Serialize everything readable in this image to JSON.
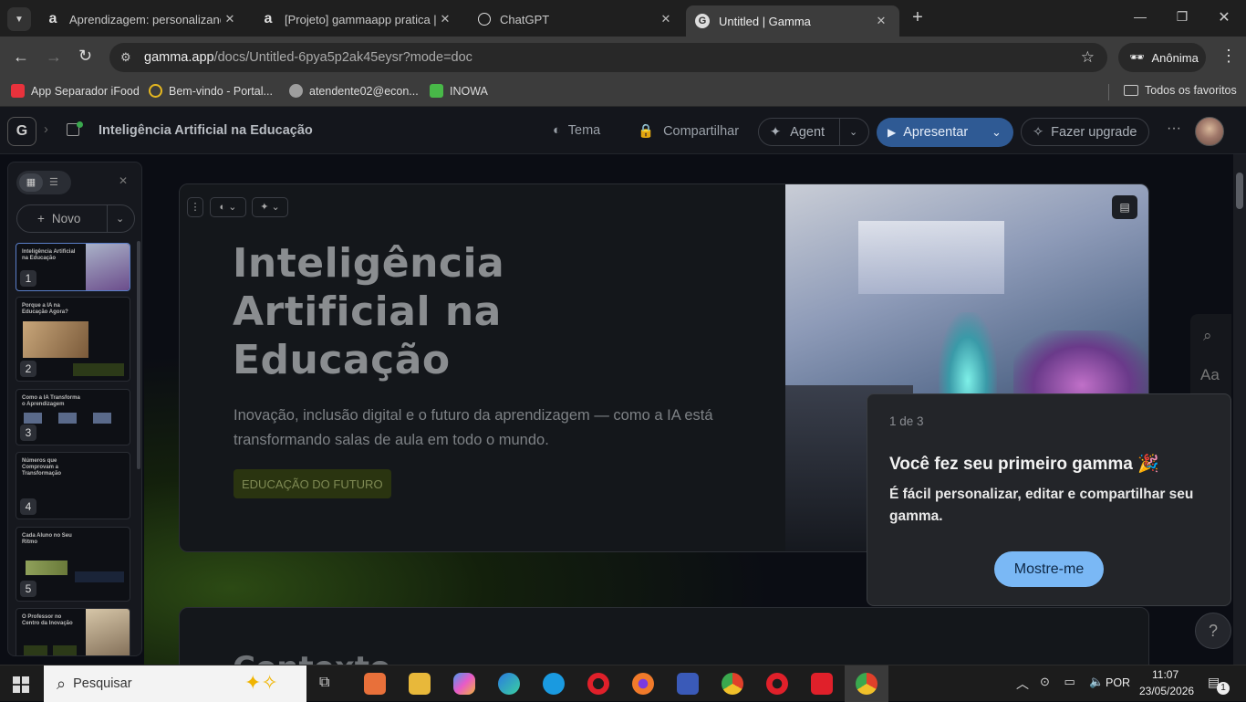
{
  "browser": {
    "tabs": [
      {
        "title": "Aprendizagem: personalizando",
        "favicon": "a"
      },
      {
        "title": "[Projeto] gammaapp pratica | A",
        "favicon": "a"
      },
      {
        "title": "ChatGPT",
        "favicon": "chatgpt-icon"
      },
      {
        "title": "Untitled | Gamma",
        "favicon": "G"
      }
    ],
    "url_host": "gamma.app",
    "url_path": "/docs/Untitled-6pya5p2ak45eysr?mode=doc",
    "profile": "Anônima",
    "bookmarks": [
      {
        "label": "App Separador iFood",
        "color": "#e8323c"
      },
      {
        "label": "Bem-vindo - Portal...",
        "color": "#e6b820"
      },
      {
        "label": "atendente02@econ...",
        "color": "#9e9e9e"
      },
      {
        "label": "INOWA",
        "color": "#48b848"
      }
    ],
    "all_bookmarks": "Todos os favoritos"
  },
  "app": {
    "doc_title": "Inteligência Artificial na Educação",
    "theme_label": "Tema",
    "share_label": "Compartilhar",
    "agent_label": "Agent",
    "present_label": "Apresentar",
    "upgrade_label": "Fazer upgrade",
    "sidebar": {
      "new_label": "Novo",
      "slides": [
        {
          "num": "1",
          "title": "Inteligência Artificial na Educação"
        },
        {
          "num": "2",
          "title": "Porque a IA na Educação Agora?"
        },
        {
          "num": "3",
          "title": "Como a IA Transforma o Aprendizagem"
        },
        {
          "num": "4",
          "title": "Números que Comprovam a Transformação"
        },
        {
          "num": "5",
          "title": "Cada Aluno no Seu Ritmo"
        },
        {
          "num": "",
          "title": "O Professor no Centro da Inovação"
        }
      ]
    },
    "card": {
      "title": "Inteligência Artificial na Educação",
      "subtitle": "Inovação, inclusão digital e o futuro da aprendizagem — como a IA está transformando salas de aula em todo o mundo.",
      "tag": "EDUCAÇÃO DO FUTURO"
    },
    "next_card_title": "Contexto",
    "popup": {
      "step": "1 de 3",
      "heading": "Você fez seu primeiro gamma 🎉",
      "body": "É fácil personalizar, editar e compartilhar seu gamma.",
      "button": "Mostre-me"
    },
    "help": "?",
    "text_tool": "Aa"
  },
  "taskbar": {
    "search_placeholder": "Pesquisar",
    "lang": "POR",
    "time": "11:07",
    "date": "23/05/2026",
    "notif_count": "1"
  },
  "colors": {
    "accent": "#7ab8f5",
    "present_bg": "#2f5a94",
    "popup_bg": "#232529"
  }
}
